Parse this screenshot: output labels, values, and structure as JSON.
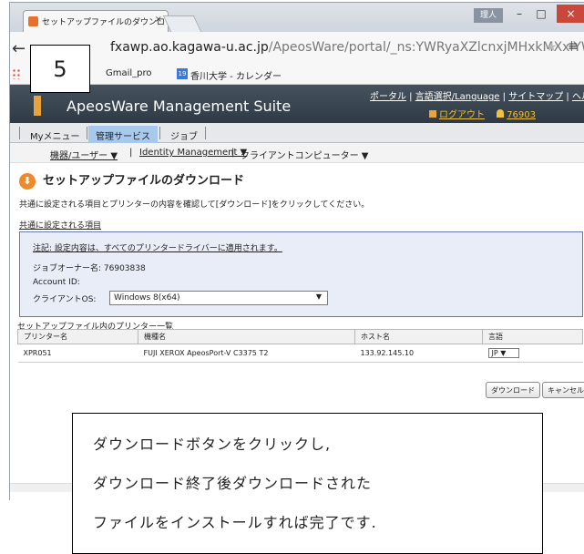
{
  "step_number": "5",
  "browser": {
    "tab_title": "セットアップファイルのダウンロー",
    "user_badge": "理人",
    "minimize": "–",
    "maximize": "□",
    "close": "×",
    "url_host": "fxawp.ao.kagawa-u.ac.jp",
    "url_path": "/ApeosWare/portal/_ns:YWRyaXZlcnxjMHxkMXxlYWl",
    "bookmarks": [
      {
        "label": "Gmail_pro"
      },
      {
        "label": "香川大学 - カレンダー",
        "icon_text": "19"
      }
    ]
  },
  "app": {
    "title": "ApeosWare Management Suite",
    "header_links": [
      "ポータル",
      "言語選択/Language",
      "サイトマップ",
      "ヘル"
    ],
    "logout": "ログアウト",
    "user_id": "76903"
  },
  "main_tabs": [
    "Myメニュー",
    "管理サービス",
    "ジョブ"
  ],
  "sub_menu": [
    "機器/ユーザー ▼",
    "|",
    "Identity Management ▼",
    "|",
    "クライアントコンピューター ▼"
  ],
  "page": {
    "heading": "セットアップファイルのダウンロード",
    "instruction": "共通に設定される項目とプリンターの内容を確認して[ダウンロード]をクリックしてください。",
    "common_section_label": "共通に設定される項目",
    "note": "注記: 設定内容は、すべてのプリンタードライバーに適用されます。",
    "job_owner_label": "ジョブオーナー名: 76903838",
    "account_id_label": "Account ID:",
    "client_os_label": "クライアントOS:",
    "client_os_value": "Windows 8(x64)",
    "printer_list_label": "セットアップファイル内のプリンター一覧",
    "table_headers": [
      "プリンター名",
      "機種名",
      "ホスト名",
      "言語"
    ],
    "table_rows": [
      {
        "printer": "XPR051",
        "model": "FUJI XEROX ApeosPort-V C3375 T2",
        "host": "133.92.145.10",
        "lang": "JP"
      }
    ],
    "download_button": "ダウンロード",
    "cancel_button": "キャンセル"
  },
  "callout_lines": [
    "ダウンロードボタンをクリックし,",
    "ダウンロード終了後ダウンロードされた",
    "ファイルをインストールすれば完了です."
  ]
}
